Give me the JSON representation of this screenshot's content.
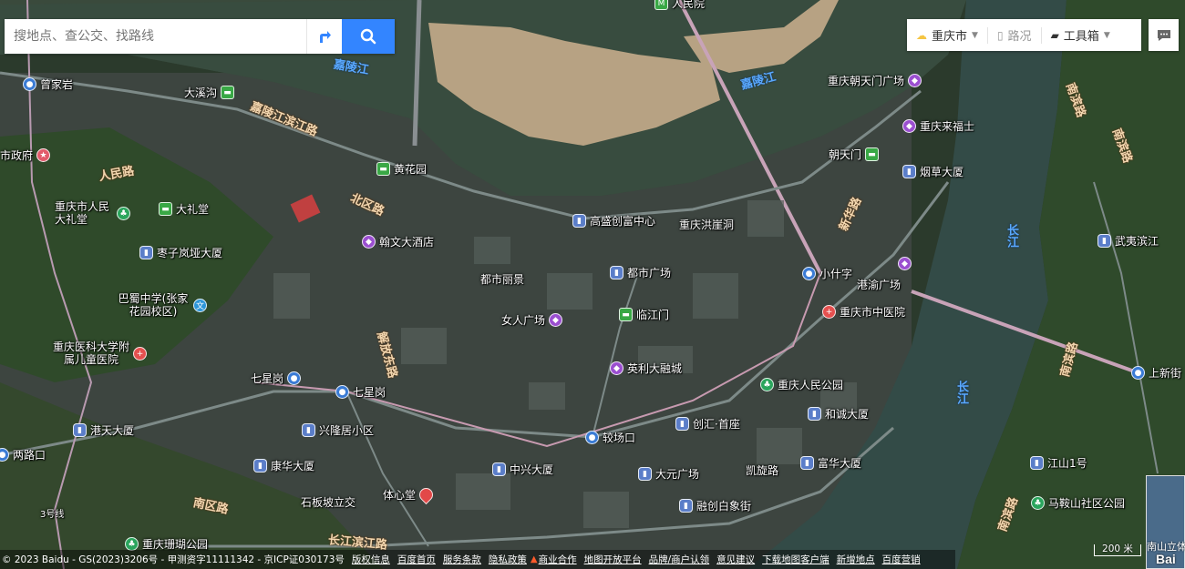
{
  "search": {
    "placeholder": "搜地点、查公交、找路线"
  },
  "toolbar": {
    "city": "重庆市",
    "traffic": "路况",
    "tools": "工具箱"
  },
  "rivers": [
    {
      "name": "嘉陵江"
    },
    {
      "name": "嘉陵江"
    },
    {
      "name": "长江"
    },
    {
      "name": "长江"
    }
  ],
  "roads": [
    {
      "name": "嘉陵江滨江路"
    },
    {
      "name": "北区路"
    },
    {
      "name": "人民路"
    },
    {
      "name": "新华路"
    },
    {
      "name": "解放东路"
    },
    {
      "name": "南区路"
    },
    {
      "name": "长江滨江路"
    },
    {
      "name": "南滨路"
    },
    {
      "name": "南滨路"
    },
    {
      "name": "南滨路"
    },
    {
      "name": "南滨路"
    }
  ],
  "pois": [
    {
      "name": "人民院",
      "icon": "metro"
    },
    {
      "name": "重庆朝天门广场",
      "icon": "mall"
    },
    {
      "name": "重庆来福士",
      "icon": "mall"
    },
    {
      "name": "朝天门",
      "icon": "rail"
    },
    {
      "name": "烟草大厦",
      "icon": "bldg"
    },
    {
      "name": "曾家岩",
      "icon": "metro"
    },
    {
      "name": "大溪沟",
      "icon": "rail"
    },
    {
      "name": "市政府",
      "icon": "gov"
    },
    {
      "name": "黄花园",
      "icon": "rail"
    },
    {
      "name": "重庆市人民大礼堂",
      "icon": "park"
    },
    {
      "name": "大礼堂",
      "icon": "rail"
    },
    {
      "name": "枣子岚垭大厦",
      "icon": "bldg"
    },
    {
      "name": "翰文大酒店",
      "icon": "mall"
    },
    {
      "name": "高盛创富中心",
      "icon": "bldg"
    },
    {
      "name": "重庆洪崖洞",
      "icon": "pin"
    },
    {
      "name": "都市丽景",
      "icon": "bldg"
    },
    {
      "name": "都市广场",
      "icon": "bldg"
    },
    {
      "name": "小什字",
      "icon": "metro"
    },
    {
      "name": "港渝广场",
      "icon": "mall"
    },
    {
      "name": "武夷滨江",
      "icon": "bldg"
    },
    {
      "name": "巴蜀中学(张家花园校区)",
      "icon": "school"
    },
    {
      "name": "女人广场",
      "icon": "mall"
    },
    {
      "name": "临江门",
      "icon": "rail"
    },
    {
      "name": "重庆市中医院",
      "icon": "hosp"
    },
    {
      "name": "重庆医科大学附属儿童医院",
      "icon": "hosp"
    },
    {
      "name": "英利大融城",
      "icon": "mall"
    },
    {
      "name": "七星岗",
      "icon": "metro"
    },
    {
      "name": "七星岗",
      "icon": "metro"
    },
    {
      "name": "重庆人民公园",
      "icon": "park"
    },
    {
      "name": "和诚大厦",
      "icon": "bldg"
    },
    {
      "name": "上新街",
      "icon": "metro"
    },
    {
      "name": "港天大厦",
      "icon": "bldg"
    },
    {
      "name": "兴隆居小区",
      "icon": "bldg"
    },
    {
      "name": "较场口",
      "icon": "metro"
    },
    {
      "name": "创汇·首座",
      "icon": "bldg"
    },
    {
      "name": "两路口",
      "icon": "metro"
    },
    {
      "name": "康华大厦",
      "icon": "bldg"
    },
    {
      "name": "中兴大厦",
      "icon": "bldg"
    },
    {
      "name": "大元广场",
      "icon": "bldg"
    },
    {
      "name": "凯旋路",
      "icon": "none"
    },
    {
      "name": "富华大厦",
      "icon": "bldg"
    },
    {
      "name": "江山1号",
      "icon": "bldg"
    },
    {
      "name": "石板坡立交",
      "icon": "none"
    },
    {
      "name": "体心堂",
      "icon": "pin"
    },
    {
      "name": "马鞍山社区公园",
      "icon": "park"
    },
    {
      "name": "融创白象街",
      "icon": "bldg"
    },
    {
      "name": "重庆珊瑚公园",
      "icon": "park"
    },
    {
      "name": "3号线",
      "icon": "none"
    }
  ],
  "footer": {
    "copyright": "© 2023 Baidu - GS(2023)3206号 - 甲测资字11111342 - 京ICP证030173号",
    "links": [
      "版权信息",
      "百度首页",
      "服务条款",
      "隐私政策",
      "商业合作",
      "地图开放平台",
      "品牌/商户认领",
      "意见建议",
      "下载地图客户端",
      "新增地点",
      "百度营销"
    ]
  },
  "scale": "200 米",
  "thumbnail_label": "南山立体",
  "logo": "Bai"
}
